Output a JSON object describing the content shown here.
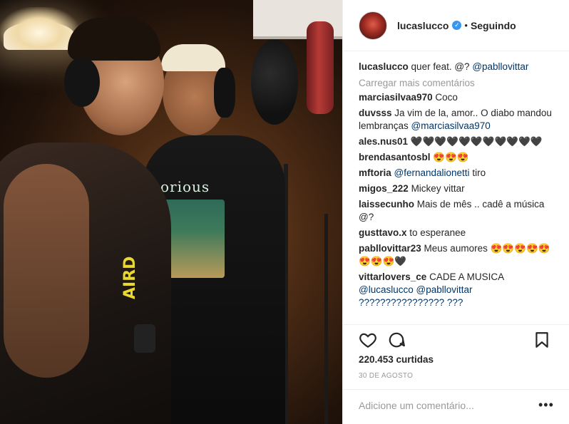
{
  "header": {
    "username": "lucaslucco",
    "separator": "•",
    "follow_status": "Seguindo"
  },
  "caption": {
    "user": "lucaslucco",
    "text": "quer feat. @?",
    "mention": "@pabllovittar"
  },
  "load_more": "Carregar mais comentários",
  "comments": [
    {
      "user": "marciasilvaa970",
      "text": "Coco",
      "mention": ""
    },
    {
      "user": "duvsss",
      "text": "Ja vim de la, amor.. O diabo mandou lembranças",
      "mention": "@marciasilvaa970"
    },
    {
      "user": "ales.nus01",
      "text": "🖤🖤🖤🖤🖤🖤🖤🖤🖤🖤🖤",
      "mention": ""
    },
    {
      "user": "brendasantosbl",
      "text": "😍😍😍",
      "mention": ""
    },
    {
      "user": "mftoria",
      "text": "tiro",
      "mention": "@fernandalionetti",
      "mention_first": true
    },
    {
      "user": "migos_222",
      "text": "Mickey vittar",
      "mention": ""
    },
    {
      "user": "laissecunho",
      "text": "Mais de mês .. cadê a música @?",
      "mention": ""
    },
    {
      "user": "gusttavo.x",
      "text": "to esperanee",
      "mention": ""
    },
    {
      "user": "pabllovittar23",
      "text": "Meus aumores 😍😍😍😍😍😍😍😍🖤",
      "mention": ""
    },
    {
      "user": "vittarlovers_ce",
      "text": "CADE A MUSICA",
      "mention": "@lucaslucco @pabllovittar ???????????????? ???"
    }
  ],
  "likes": "220.453 curtidas",
  "date": "30 DE AGOSTO",
  "comment_input": {
    "placeholder": "Adicione um comentário...",
    "value": ""
  },
  "icons": [
    "heart-icon",
    "comment-icon",
    "bookmark-icon",
    "more-options-icon",
    "verified-icon"
  ],
  "photo": {
    "shirt_text": "orious",
    "shirt_side_text": "AIRD"
  },
  "colors": {
    "link": "#003569",
    "muted": "#999999",
    "verified": "#3897f0"
  }
}
